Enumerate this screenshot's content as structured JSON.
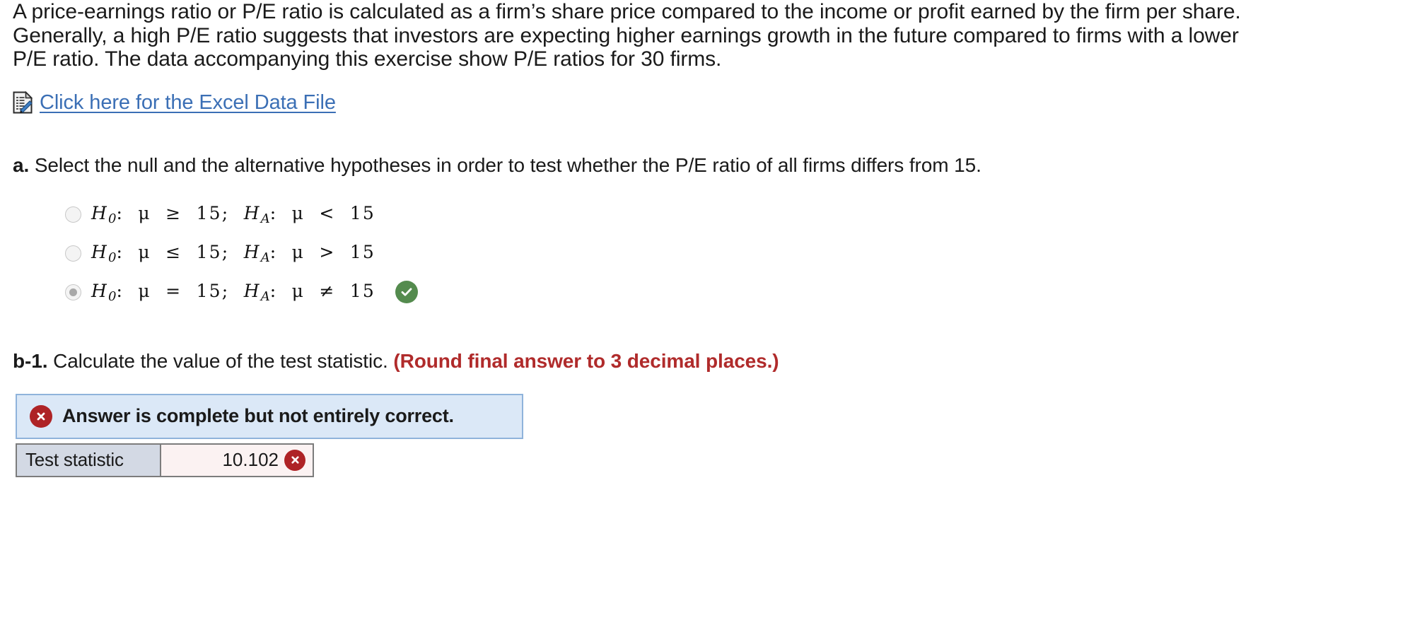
{
  "intro": {
    "lines": [
      "A price-earnings ratio or P/E ratio is calculated as a firm’s share price compared to the income or profit earned by the firm per share.",
      "Generally, a high P/E ratio suggests that investors are expecting higher earnings growth in the future compared to firms with a lower",
      "P/E ratio. The data accompanying this exercise show P/E ratios for 30 firms."
    ]
  },
  "datafile": {
    "icon": "excel-document-icon",
    "link_text": "Click here for the Excel Data File",
    "link_color": "#3b6fb5"
  },
  "part_a": {
    "label": "a.",
    "prompt": "Select the null and the alternative hypotheses in order to test whether the P/E ratio of all firms differs from 15.",
    "options": [
      {
        "id": "option-1",
        "selected": false,
        "null_name": "H",
        "null_sub": "0",
        "null_body": ":  μ  ≥  15;  ",
        "alt_name": "H",
        "alt_sub": "A",
        "alt_body": ":  μ  <  15",
        "graded": false
      },
      {
        "id": "option-2",
        "selected": false,
        "null_name": "H",
        "null_sub": "0",
        "null_body": ":  μ  ≤  15;  ",
        "alt_name": "H",
        "alt_sub": "A",
        "alt_body": ":  μ  >  15",
        "graded": false
      },
      {
        "id": "option-3",
        "selected": true,
        "null_name": "H",
        "null_sub": "0",
        "null_body": ":  μ  =  15;  ",
        "alt_name": "H",
        "alt_sub": "A",
        "alt_body": ":  μ  ≠  15",
        "graded": true,
        "grade_icon": "correct-check-icon",
        "grade_color": "#548b4e"
      }
    ]
  },
  "part_b1": {
    "label": "b-1.",
    "prompt": "Calculate the value of the test statistic.",
    "round_note": "(Round final answer to 3 decimal places.)",
    "round_note_color": "#b02b2b"
  },
  "status_banner": {
    "icon": "incorrect-x-icon",
    "text": "Answer is complete but not entirely correct.",
    "background": "#dbe8f7",
    "border": "#8fb3db",
    "icon_color": "#ae2326"
  },
  "answer_table": {
    "rows": [
      {
        "label": "Test statistic",
        "value": "10.102",
        "status_icon": "incorrect-x-icon",
        "label_bg": "#d3d9e4",
        "value_bg": "#fbf2f2"
      }
    ]
  }
}
